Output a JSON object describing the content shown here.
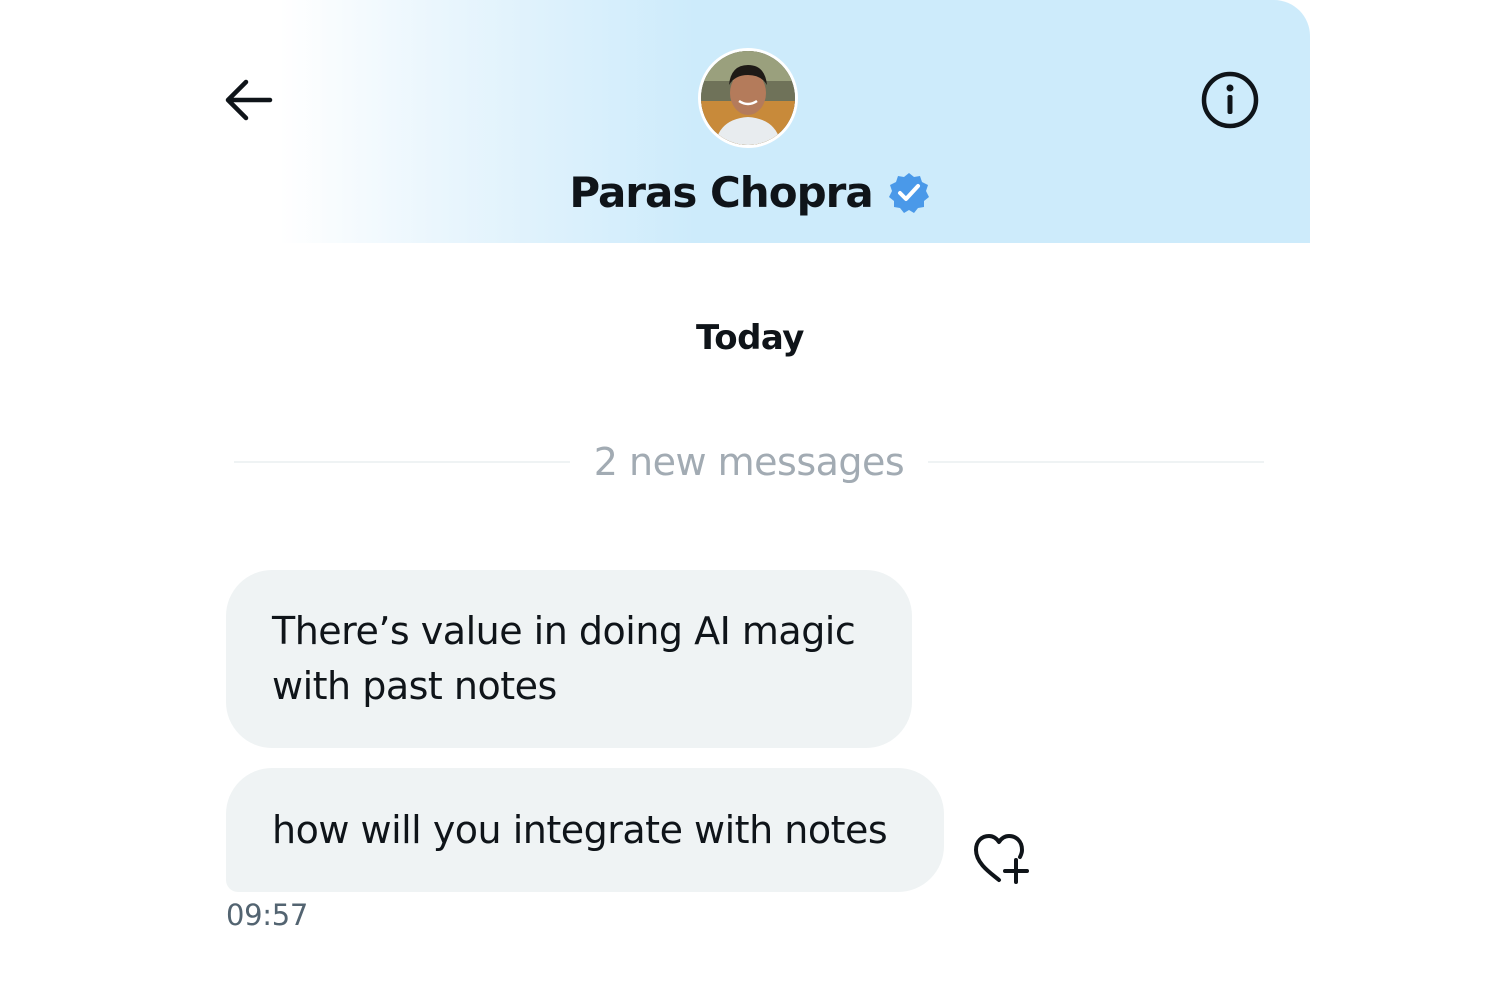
{
  "header": {
    "contact_name": "Paras Chopra",
    "back_icon": "arrow-left-icon",
    "info_icon": "info-circle-icon",
    "verified_icon": "verified-badge-icon",
    "verified_color": "#4a99e9"
  },
  "conversation": {
    "date_label": "Today",
    "new_messages_label": "2 new messages",
    "messages": [
      {
        "text": "There’s value in doing AI magic with past notes"
      },
      {
        "text": "how will you integrate with notes"
      }
    ],
    "timestamp": "09:57",
    "react_icon": "heart-plus-icon"
  },
  "colors": {
    "header_gradient_end": "#cdebfb",
    "bubble_background": "#eff3f4",
    "text_primary": "#0f1419",
    "text_muted": "#a2abb3",
    "text_secondary": "#536471"
  }
}
